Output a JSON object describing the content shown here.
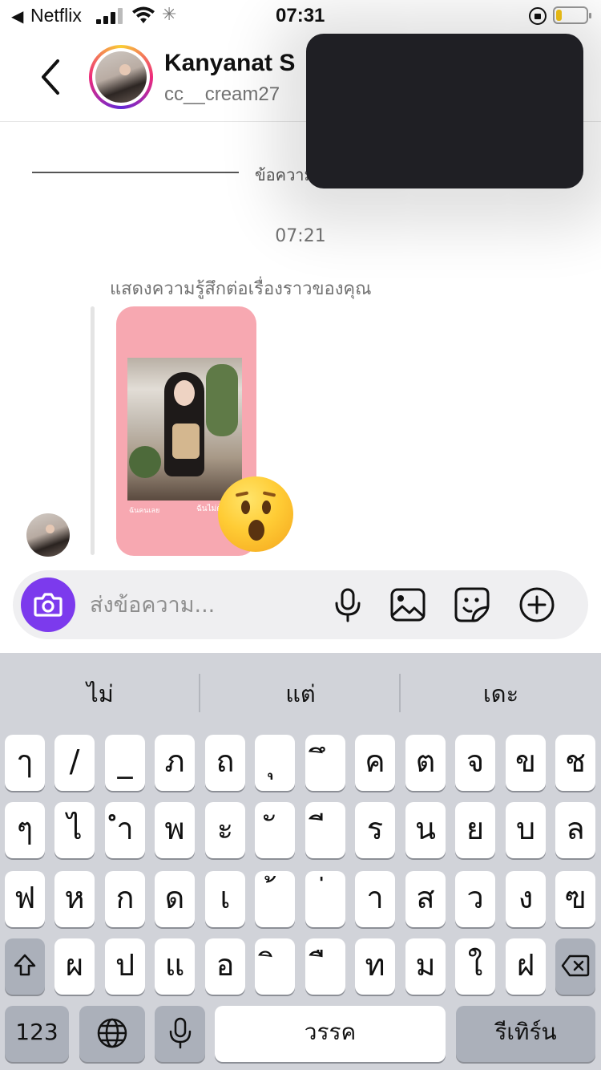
{
  "status_bar": {
    "back_app": "Netflix",
    "time": "07:31",
    "battery_level": 0.2
  },
  "header": {
    "name": "Kanyanat S",
    "username": "cc__cream27"
  },
  "chat": {
    "divider_text": "ข้อความ",
    "timestamp": "07:21",
    "reply_label": "แสดงความรู้สึกต่อเรื่องราวของคุณ",
    "story_captions": [
      "ฉันคนเลย",
      "ฉันไม่ต้อง"
    ],
    "reaction_emoji": "astonished-face"
  },
  "composer": {
    "placeholder": "ส่งข้อความ..."
  },
  "keyboard": {
    "suggestions": [
      "ไม่",
      "แต่",
      "เดะ"
    ],
    "row1": [
      "ๅ",
      "/",
      "_",
      "ภ",
      "ถ",
      "ุ",
      "ึ",
      "ค",
      "ต",
      "จ",
      "ข",
      "ช"
    ],
    "row2": [
      "ๆ",
      "ไ",
      "ำ",
      "พ",
      "ะ",
      "ั",
      "ี",
      "ร",
      "น",
      "ย",
      "บ",
      "ล"
    ],
    "row3": [
      "ฟ",
      "ห",
      "ก",
      "ด",
      "เ",
      "้",
      "่",
      "า",
      "ส",
      "ว",
      "ง",
      "ฃ"
    ],
    "row4": [
      "ผ",
      "ป",
      "แ",
      "อ",
      "ิ",
      "ื",
      "ท",
      "ม",
      "ใ",
      "ฝ"
    ],
    "numbers_key": "123",
    "space_key": "วรรค",
    "return_key": "รีเทิร์น"
  }
}
